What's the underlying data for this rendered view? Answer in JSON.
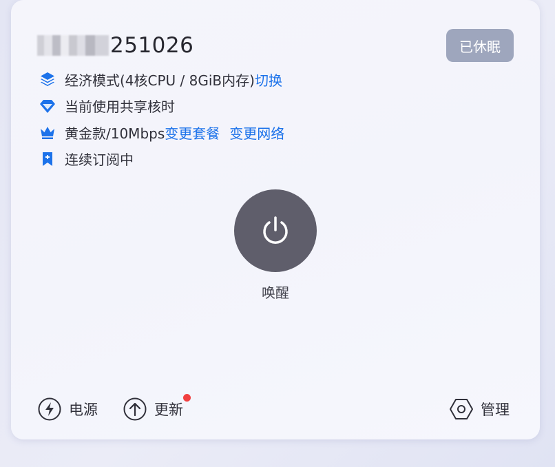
{
  "device": {
    "id_visible": "251026",
    "status": "已休眠"
  },
  "info": {
    "mode_text": "经济模式(4核CPU / 8GiB内存)",
    "mode_link": "切换",
    "core_text": "当前使用共享核时",
    "plan_text": "黄金款/10Mbps",
    "plan_link": "变更套餐",
    "network_link": "变更网络",
    "subscription_text": "连续订阅中"
  },
  "power": {
    "label": "唤醒"
  },
  "footer": {
    "power_label": "电源",
    "update_label": "更新",
    "manage_label": "管理"
  },
  "colors": {
    "accent": "#1c72ea",
    "badge_bg": "#9ea6bd",
    "power_button": "#5f5e6b",
    "notification_dot": "#f14040"
  },
  "icons": {
    "mode": "layers-icon",
    "core": "diamond-icon",
    "plan": "crown-icon",
    "subscription": "bookmark-icon",
    "power_button": "power-icon",
    "footer_power": "lightning-icon",
    "footer_update": "arrow-up-icon",
    "footer_manage": "hexagon-settings-icon"
  }
}
